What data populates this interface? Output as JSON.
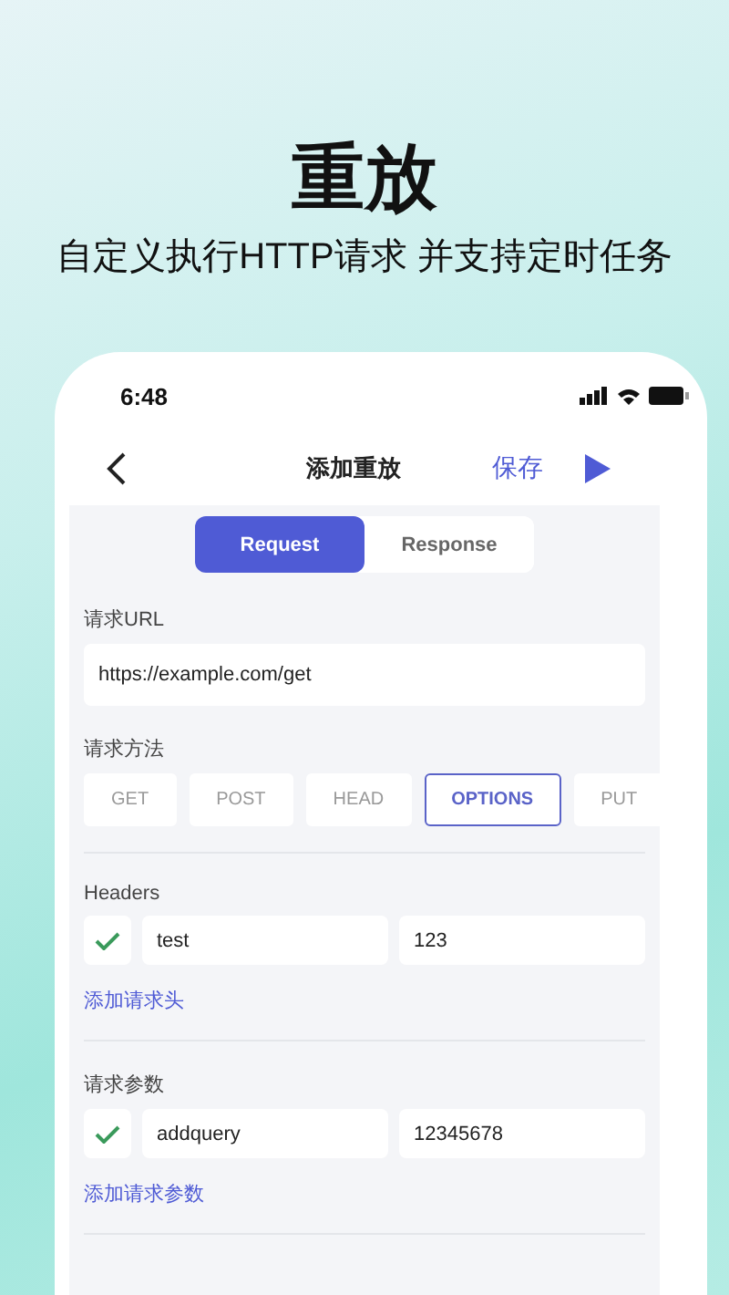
{
  "headline": "重放",
  "subtitle": "自定义执行HTTP请求 并支持定时任务",
  "status_bar": {
    "time": "6:48"
  },
  "nav": {
    "title": "添加重放",
    "save": "保存"
  },
  "tabs": [
    {
      "label": "Request",
      "selected": true
    },
    {
      "label": "Response",
      "selected": false
    }
  ],
  "url": {
    "label": "请求URL",
    "value": "https://example.com/get"
  },
  "method": {
    "label": "请求方法",
    "options": [
      {
        "label": "GET",
        "selected": false
      },
      {
        "label": "POST",
        "selected": false
      },
      {
        "label": "HEAD",
        "selected": false
      },
      {
        "label": "OPTIONS",
        "selected": true
      },
      {
        "label": "PUT",
        "selected": false
      }
    ]
  },
  "headers": {
    "label": "Headers",
    "rows": [
      {
        "checked": true,
        "key": "test",
        "value": "123"
      }
    ],
    "add": "添加请求头"
  },
  "params": {
    "label": "请求参数",
    "rows": [
      {
        "checked": true,
        "key": "addquery",
        "value": "12345678"
      }
    ],
    "add": "添加请求参数"
  }
}
